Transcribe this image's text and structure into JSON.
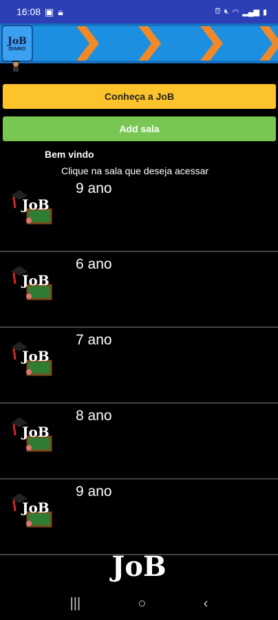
{
  "status": {
    "time": "16:08",
    "left_icons": [
      "ratio-icon",
      "lock-icon"
    ],
    "right_icons": [
      "alarm-icon",
      "mute-icon",
      "wifi-icon",
      "signal-icon",
      "battery-icon"
    ]
  },
  "header": {
    "logo_line1": "JoB",
    "logo_line2": "DIARIO"
  },
  "actions": {
    "about_label": "Conheça a JoB",
    "add_room_label": "Add sala"
  },
  "greeting": {
    "welcome": "Bem vindo",
    "instruction": "Clique na sala que deseja acessar"
  },
  "rooms": [
    {
      "name": "9 ano"
    },
    {
      "name": "6 ano"
    },
    {
      "name": "7 ano"
    },
    {
      "name": "8 ano"
    },
    {
      "name": "9 ano"
    }
  ],
  "footer": {
    "logo": "JoB"
  },
  "colors": {
    "statusbar": "#2d3fb5",
    "banner": "#1d8fe0",
    "arrow": "#f0892a",
    "about_button": "#fdc32a",
    "add_button": "#79c652"
  }
}
